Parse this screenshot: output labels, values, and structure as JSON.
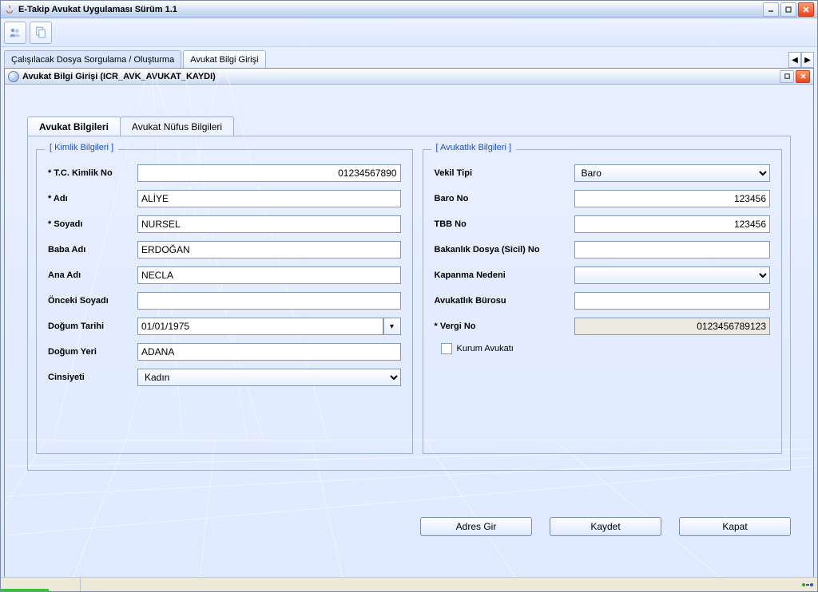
{
  "window": {
    "title": "E-Takip Avukat Uygulaması Sürüm 1.1"
  },
  "outer_tabs": {
    "tab1": "Çalışılacak Dosya Sorgulama / Oluşturma",
    "tab2": "Avukat Bilgi Girişi"
  },
  "inner_window": {
    "title": "Avukat Bilgi Girişi (ICR_AVK_AVUKAT_KAYDI)"
  },
  "tabs": {
    "tab1": "Avukat  Bilgileri",
    "tab2": "Avukat Nüfus Bilgileri"
  },
  "groups": {
    "kimlik": "[ Kimlik Bilgileri ]",
    "avukatlik": "[ Avukatlık Bilgileri ]"
  },
  "left": {
    "tc_label": "* T.C. Kimlik No",
    "tc_value": "01234567890",
    "adi_label": "* Adı",
    "adi_value": "ALİYE",
    "soyadi_label": "* Soyadı",
    "soyadi_value": "NURSEL",
    "baba_label": "Baba Adı",
    "baba_value": "ERDOĞAN",
    "ana_label": "Ana Adı",
    "ana_value": "NECLA",
    "onceki_label": "Önceki Soyadı",
    "onceki_value": "",
    "dogum_tarihi_label": "Doğum Tarihi",
    "dogum_tarihi_value": "01/01/1975",
    "dogum_yeri_label": "Doğum Yeri",
    "dogum_yeri_value": "ADANA",
    "cinsiyet_label": "Cinsiyeti",
    "cinsiyet_value": "Kadın"
  },
  "right": {
    "vekil_label": "Vekil Tipi",
    "vekil_value": "Baro",
    "baro_label": "Baro No",
    "baro_value": "123456",
    "tbb_label": "TBB No",
    "tbb_value": "123456",
    "bakanlik_label": "Bakanlık Dosya (Sicil) No",
    "bakanlik_value": "",
    "kapanma_label": "Kapanma Nedeni",
    "kapanma_value": "",
    "burosu_label": "Avukatlık Bürosu",
    "burosu_value": "",
    "vergi_label": "* Vergi No",
    "vergi_value": "0123456789123",
    "kurum_label": "Kurum Avukatı"
  },
  "actions": {
    "adres": "Adres Gir",
    "kaydet": "Kaydet",
    "kapat": "Kapat"
  }
}
